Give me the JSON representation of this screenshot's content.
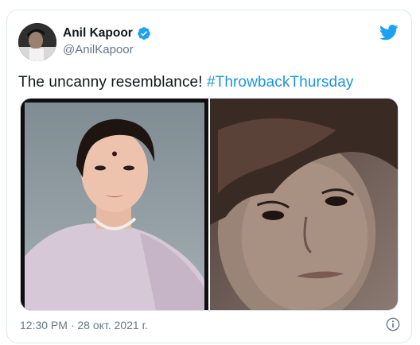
{
  "author": {
    "name": "Anil Kapoor",
    "handle": "@AnilKapoor",
    "verified": true
  },
  "tweet": {
    "text": "The uncanny resemblance! ",
    "hashtag": "#ThrowbackThursday"
  },
  "media": [
    {
      "icon": "portrait-woman-photo"
    },
    {
      "icon": "portrait-young-man-photo"
    }
  ],
  "meta": {
    "timestamp": "12:30 PM · 28 окт. 2021 г."
  },
  "colors": {
    "link": "#1b95e0",
    "muted": "#657786",
    "border": "#e1e8ed"
  }
}
